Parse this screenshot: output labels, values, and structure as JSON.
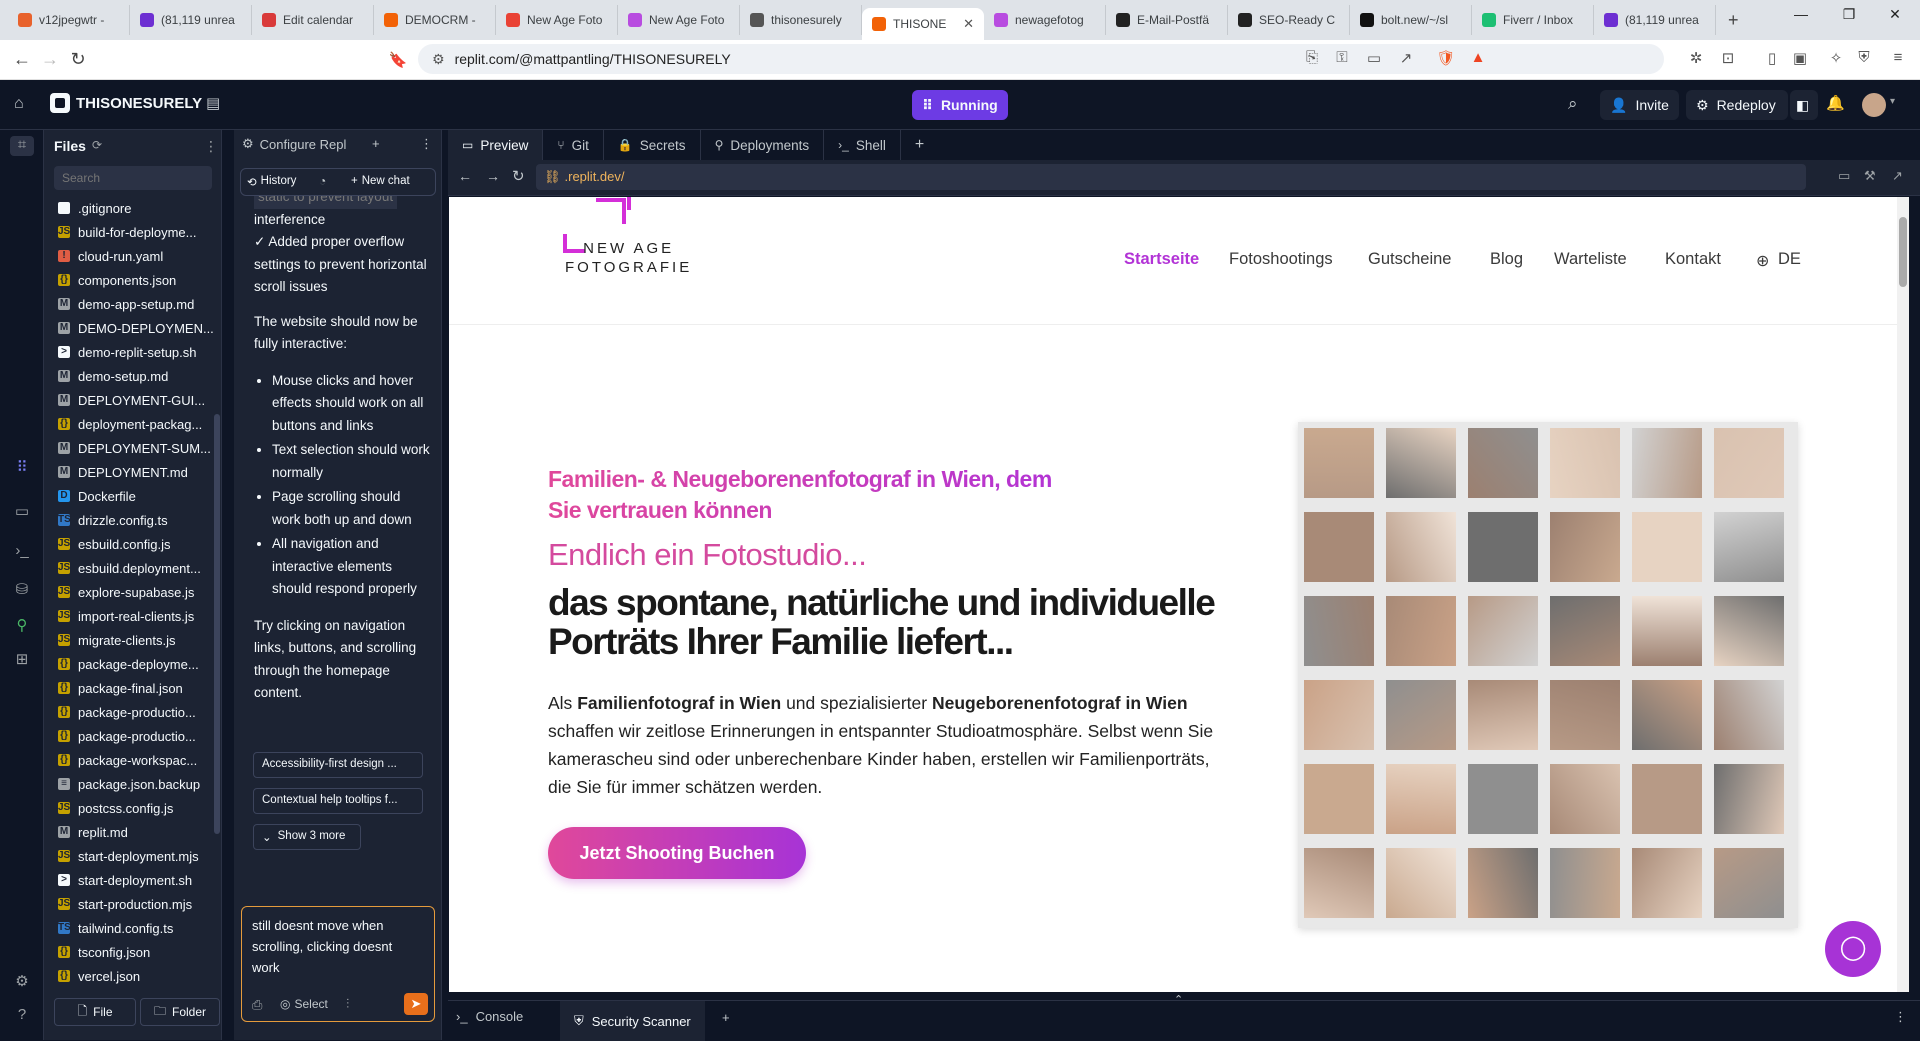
{
  "browser": {
    "tabs": [
      {
        "label": "v12jpegwtr -",
        "color": "#e8622c"
      },
      {
        "label": "(81,119 unrea",
        "color": "#6d2fd2"
      },
      {
        "label": "Edit calendar",
        "color": "#d93a3a"
      },
      {
        "label": "DEMOCRM -",
        "color": "#f26207"
      },
      {
        "label": "New Age Foto",
        "color": "#e94235"
      },
      {
        "label": "New Age Foto",
        "color": "#b84ce0"
      },
      {
        "label": "thisonesurely",
        "color": "#555555"
      },
      {
        "label": "THISONE",
        "color": "#f26207",
        "active": true
      },
      {
        "label": "newagefotog",
        "color": "#b84ce0"
      },
      {
        "label": "E-Mail-Postfä",
        "color": "#222222"
      },
      {
        "label": "SEO-Ready C",
        "color": "#222222"
      },
      {
        "label": "bolt.new/~/sl",
        "color": "#111111"
      },
      {
        "label": "Fiverr / Inbox",
        "color": "#1dbf73"
      },
      {
        "label": "(81,119 unrea",
        "color": "#6d2fd2"
      }
    ],
    "url": "replit.com/@mattpantling/THISONESURELY"
  },
  "replit": {
    "project_name": "THISONESURELY",
    "status": "Running",
    "invite_label": "Invite",
    "redeploy_label": "Redeploy"
  },
  "files": {
    "title": "Files",
    "search_placeholder": "Search",
    "items": [
      {
        "name": ".gitignore",
        "icon": "#f5f9fc",
        "glyph": ""
      },
      {
        "name": "build-for-deployme...",
        "icon": "#c5a100",
        "glyph": "JS"
      },
      {
        "name": "cloud-run.yaml",
        "icon": "#e05d44",
        "glyph": "!"
      },
      {
        "name": "components.json",
        "icon": "#c5a100",
        "glyph": "{}"
      },
      {
        "name": "demo-app-setup.md",
        "icon": "#9da2a6",
        "glyph": "M"
      },
      {
        "name": "DEMO-DEPLOYMEN...",
        "icon": "#9da2a6",
        "glyph": "M"
      },
      {
        "name": "demo-replit-setup.sh",
        "icon": "#f5f9fc",
        "glyph": ">"
      },
      {
        "name": "demo-setup.md",
        "icon": "#9da2a6",
        "glyph": "M"
      },
      {
        "name": "DEPLOYMENT-GUI...",
        "icon": "#9da2a6",
        "glyph": "M"
      },
      {
        "name": "deployment-packag...",
        "icon": "#c5a100",
        "glyph": "{}"
      },
      {
        "name": "DEPLOYMENT-SUM...",
        "icon": "#9da2a6",
        "glyph": "M"
      },
      {
        "name": "DEPLOYMENT.md",
        "icon": "#9da2a6",
        "glyph": "M"
      },
      {
        "name": "Dockerfile",
        "icon": "#2496ed",
        "glyph": "D"
      },
      {
        "name": "drizzle.config.ts",
        "icon": "#3178c6",
        "glyph": "TS"
      },
      {
        "name": "esbuild.config.js",
        "icon": "#c5a100",
        "glyph": "JS"
      },
      {
        "name": "esbuild.deployment...",
        "icon": "#c5a100",
        "glyph": "JS"
      },
      {
        "name": "explore-supabase.js",
        "icon": "#c5a100",
        "glyph": "JS"
      },
      {
        "name": "import-real-clients.js",
        "icon": "#c5a100",
        "glyph": "JS"
      },
      {
        "name": "migrate-clients.js",
        "icon": "#c5a100",
        "glyph": "JS"
      },
      {
        "name": "package-deployme...",
        "icon": "#c5a100",
        "glyph": "{}"
      },
      {
        "name": "package-final.json",
        "icon": "#c5a100",
        "glyph": "{}"
      },
      {
        "name": "package-productio...",
        "icon": "#c5a100",
        "glyph": "{}"
      },
      {
        "name": "package-productio...",
        "icon": "#c5a100",
        "glyph": "{}"
      },
      {
        "name": "package-workspac...",
        "icon": "#c5a100",
        "glyph": "{}"
      },
      {
        "name": "package.json.backup",
        "icon": "#9da2a6",
        "glyph": "≡"
      },
      {
        "name": "postcss.config.js",
        "icon": "#c5a100",
        "glyph": "JS"
      },
      {
        "name": "replit.md",
        "icon": "#9da2a6",
        "glyph": "M"
      },
      {
        "name": "start-deployment.mjs",
        "icon": "#c5a100",
        "glyph": "JS"
      },
      {
        "name": "start-deployment.sh",
        "icon": "#f5f9fc",
        "glyph": ">"
      },
      {
        "name": "start-production.mjs",
        "icon": "#c5a100",
        "glyph": "JS"
      },
      {
        "name": "tailwind.config.ts",
        "icon": "#3178c6",
        "glyph": "TS"
      },
      {
        "name": "tsconfig.json",
        "icon": "#c5a100",
        "glyph": "{}"
      },
      {
        "name": "vercel.json",
        "icon": "#c5a100",
        "glyph": "{}"
      }
    ],
    "new_file_label": "File",
    "new_folder_label": "Folder"
  },
  "agent": {
    "tab_label": "Configure Repl",
    "history_label": "History",
    "new_chat_label": "New chat",
    "cut_text": "static to prevent layout",
    "para1_line1": "interference",
    "para1_line2": "✓ Added proper overflow settings to prevent horizontal scroll issues",
    "para2": "The website should now be fully interactive:",
    "bullets": [
      "Mouse clicks and hover effects should work on all buttons and links",
      "Text selection should work normally",
      "Page scrolling should work both up and down",
      "All navigation and interactive elements should respond properly"
    ],
    "para3": "Try clicking on navigation links, buttons, and scrolling through the homepage content.",
    "suggestions": [
      "Accessibility-first design ...",
      "Contextual help tooltips f..."
    ],
    "show_more_label": "Show 3 more",
    "input_text": "still doesnt move when scrolling, clicking doesnt work",
    "select_label": "Select"
  },
  "workspace": {
    "tabs": [
      "Preview",
      "Git",
      "Secrets",
      "Deployments",
      "Shell"
    ],
    "preview_url": ".replit.dev/"
  },
  "website": {
    "logo_line1": "NEW AGE",
    "logo_line2": "FOTOGRAFIE",
    "nav": [
      "Startseite",
      "Fotoshootings",
      "Gutscheine",
      "Blog",
      "Warteliste",
      "Kontakt",
      "DE"
    ],
    "tagline": "Familien- & Neugeborenenfotograf in Wien, dem Sie vertrauen können",
    "headline1": "Endlich ein Fotostudio...",
    "headline2": "das spontane, natürliche und individuelle Porträts Ihrer Familie liefert...",
    "body_prefix": "Als ",
    "body_bold1": "Familienfotograf in Wien",
    "body_mid": " und spezialisierter ",
    "body_bold2": "Neugeborenenfotograf in Wien",
    "body_rest": " schaffen wir zeitlose Erinnerungen in entspannter Studioatmosphäre. Selbst wenn Sie kamerascheu sind oder unberechenbare Kinder haben, erstellen wir Familienporträts, die Sie für immer schätzen werden.",
    "cta_label": "Jetzt Shooting Buchen",
    "accent_color": "#c23ad6"
  },
  "bottom": {
    "tabs": [
      "Console",
      "Security Scanner"
    ]
  }
}
